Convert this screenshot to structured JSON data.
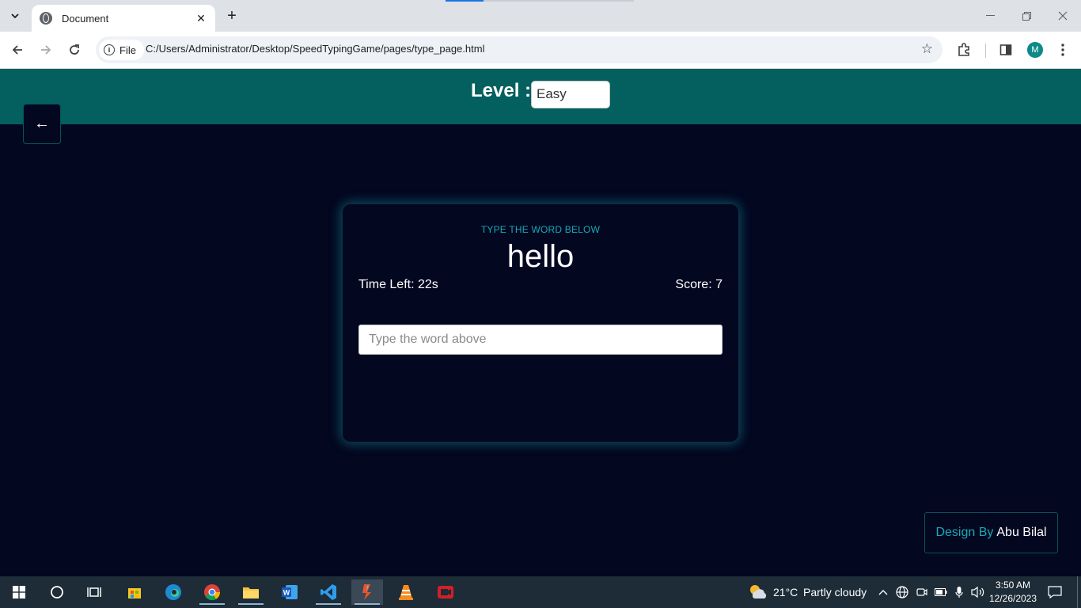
{
  "browser": {
    "tab_title": "Document",
    "tab_close": "✕",
    "new_tab": "+",
    "chip_label": "File",
    "url": "C:/Users/Administrator/Desktop/SpeedTypingGame/pages/type_page.html",
    "profile_initial": "M"
  },
  "page": {
    "level_label": "Level :",
    "level_value": "Easy",
    "back_arrow": "←",
    "card": {
      "hint": "TYPE THE WORD BELOW",
      "word": "hello",
      "time_left": "Time Left: 22s",
      "score": "Score: 7",
      "input_placeholder": "Type the word above"
    },
    "credit": {
      "prefix": "Design By",
      "name": "Abu Bilal"
    },
    "colors": {
      "header_bg": "#045f5f",
      "page_bg": "#030720",
      "accent": "#17a9b5"
    }
  },
  "taskbar": {
    "weather_temp": "21°C",
    "weather_desc": "Partly cloudy",
    "time": "3:50 AM",
    "date": "12/26/2023",
    "apps": [
      "start-icon",
      "search-icon",
      "task-view-icon",
      "store-icon",
      "edge-icon",
      "chrome-icon",
      "file-explorer-icon",
      "word-icon",
      "vscode-icon",
      "app-icon",
      "vlc-icon",
      "recorder-icon"
    ]
  }
}
